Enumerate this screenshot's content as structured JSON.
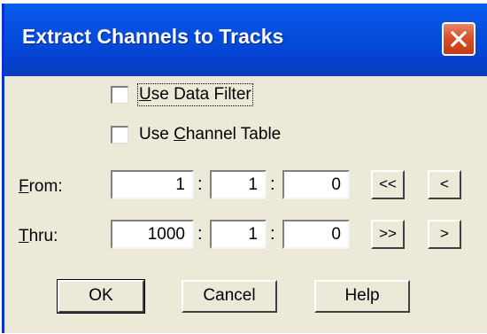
{
  "dialog": {
    "title": "Extract Channels to Tracks"
  },
  "options": {
    "use_data_filter": {
      "mnemonic": "U",
      "rest": "se Data Filter",
      "checked": false
    },
    "use_channel_table": {
      "pre": "Use ",
      "mnemonic": "C",
      "rest": "hannel Table",
      "checked": false
    }
  },
  "from": {
    "mnemonic": "F",
    "rest": "rom:",
    "measure": "1",
    "beat": "1",
    "tick": "0",
    "colon": ":",
    "rewind_label": "<<",
    "prev_label": "<"
  },
  "thru": {
    "mnemonic": "T",
    "rest": "hru:",
    "measure": "1000",
    "beat": "1",
    "tick": "0",
    "colon": ":",
    "end_label": ">>",
    "next_label": ">"
  },
  "buttons": {
    "ok": "OK",
    "cancel": "Cancel",
    "help": "Help"
  },
  "colors": {
    "titlebar": "#0349d8",
    "dialog_face": "#ece9d8",
    "close_button": "#d8502a"
  }
}
